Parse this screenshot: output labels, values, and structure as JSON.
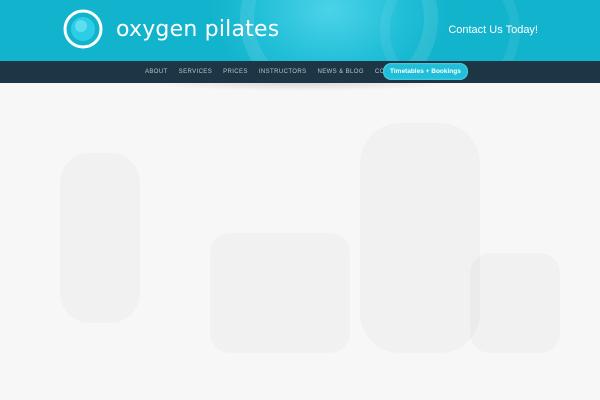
{
  "brand": {
    "name": "oxygen pilates",
    "accent": "#1fbfd9",
    "nav_bg": "#1d3646"
  },
  "header": {
    "contact_label": "Contact Us Today!"
  },
  "nav": {
    "items": [
      "ABOUT",
      "SERVICES",
      "PRICES",
      "INSTRUCTORS",
      "NEWS & BLOG",
      "CONTACT"
    ],
    "cta_label": "Timetables + Bookings"
  }
}
